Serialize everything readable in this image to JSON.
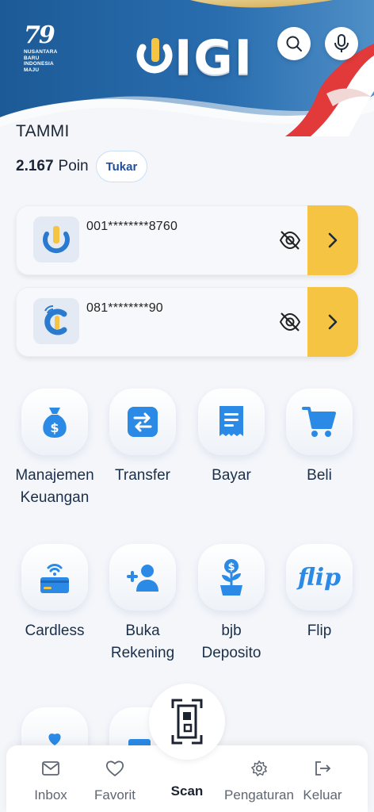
{
  "header": {
    "badge_number": "79",
    "badge_caption": [
      "NUSANTARA",
      "BARU",
      "INDONESIA",
      "MAJU"
    ],
    "brand": "IGI",
    "icons": [
      "search-icon",
      "microphone-icon"
    ]
  },
  "profile": {
    "name": "TAMMI",
    "points_value": "2.167",
    "points_unit": "Poin",
    "redeem_label": "Tukar"
  },
  "accounts": [
    {
      "number": "001********8760",
      "logo": "digi-logo-icon",
      "icon": "eye-off-icon"
    },
    {
      "number": "081********90",
      "logo": "cash-logo-icon",
      "icon": "eye-off-icon"
    }
  ],
  "menu": [
    {
      "label_lines": [
        "Manajemen",
        "Keuangan"
      ],
      "icon": "money-bag-icon"
    },
    {
      "label_lines": [
        "Transfer",
        ""
      ],
      "icon": "transfer-arrows-icon"
    },
    {
      "label_lines": [
        "Bayar",
        ""
      ],
      "icon": "receipt-icon"
    },
    {
      "label_lines": [
        "Beli",
        ""
      ],
      "icon": "cart-icon"
    },
    {
      "label_lines": [
        "Cardless",
        ""
      ],
      "icon": "contactless-card-icon"
    },
    {
      "label_lines": [
        "Buka",
        "Rekening"
      ],
      "icon": "add-user-icon"
    },
    {
      "label_lines": [
        "bjb",
        "Deposito"
      ],
      "icon": "money-plant-icon"
    },
    {
      "label_lines": [
        "Flip",
        ""
      ],
      "icon": "flip-logo-icon",
      "icon_text": "flip"
    }
  ],
  "bottom_nav": [
    {
      "label": "Inbox",
      "icon": "mail-icon"
    },
    {
      "label": "Favorit",
      "icon": "heart-icon"
    },
    {
      "label": "Scan",
      "icon": "qr-scan-icon",
      "active": true
    },
    {
      "label": "Pengaturan",
      "icon": "gear-icon"
    },
    {
      "label": "Keluar",
      "icon": "logout-icon"
    }
  ],
  "colors": {
    "header_blue": "#1f5f9c",
    "accent_yellow": "#f6c443",
    "icon_blue": "#2b8ae6",
    "text_dark": "#1b2f4a"
  }
}
